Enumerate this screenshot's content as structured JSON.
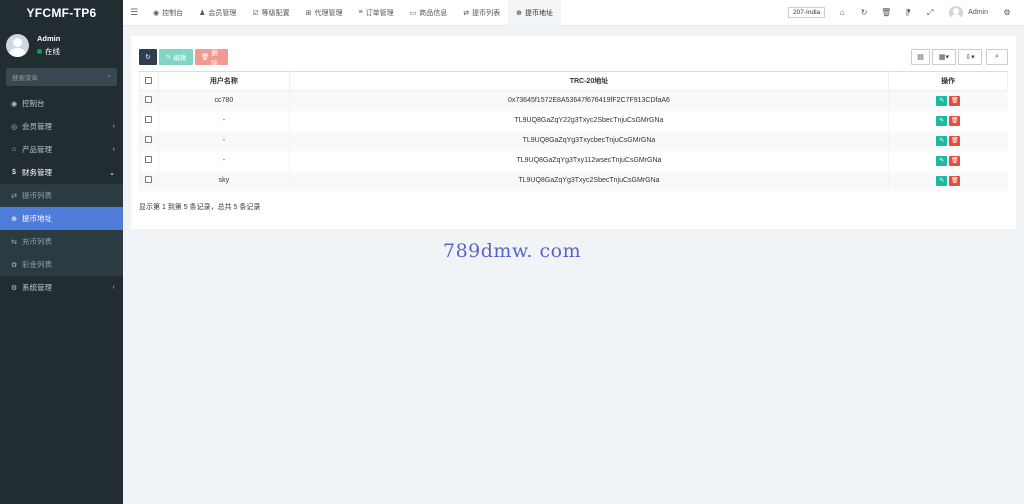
{
  "sidebar": {
    "logo": "YFCMF-TP6",
    "user": {
      "name": "Admin",
      "status": "在线"
    },
    "search_placeholder": "搜索菜单",
    "items": [
      {
        "label": "控制台",
        "icon": "dashboard-icon",
        "type": "top",
        "glyph": "◉"
      },
      {
        "label": "会员管理",
        "icon": "user-circle-icon",
        "type": "top",
        "glyph": "◎",
        "chevron": "‹"
      },
      {
        "label": "产品管理",
        "icon": "home-icon",
        "type": "top",
        "glyph": "⌂",
        "chevron": "‹"
      },
      {
        "label": "财务管理",
        "icon": "dollar-icon",
        "type": "open",
        "glyph": "$",
        "chevron": "⌄"
      },
      {
        "label": "提币列表",
        "icon": "transfer-icon",
        "type": "sub",
        "glyph": "⇄"
      },
      {
        "label": "提币地址",
        "icon": "globe-icon",
        "type": "active",
        "glyph": "⊕"
      },
      {
        "label": "充币列表",
        "icon": "transfer-in-icon",
        "type": "sub",
        "glyph": "⇆"
      },
      {
        "label": "彩金列表",
        "icon": "gift-icon",
        "type": "sub",
        "glyph": "✿"
      },
      {
        "label": "系统管理",
        "icon": "cogs-icon",
        "type": "top",
        "glyph": "⚙",
        "chevron": "‹"
      }
    ]
  },
  "topbar": {
    "tabs": [
      {
        "label": "控制台",
        "icon": "dashboard-icon",
        "glyph": "◉"
      },
      {
        "label": "会员管理",
        "icon": "user-icon",
        "glyph": "♟"
      },
      {
        "label": "等级配置",
        "icon": "check-square-icon",
        "glyph": "☑"
      },
      {
        "label": "代理管理",
        "icon": "sitemap-icon",
        "glyph": "⊞"
      },
      {
        "label": "订单管理",
        "icon": "list-icon",
        "glyph": "≡"
      },
      {
        "label": "商品信息",
        "icon": "monitor-icon",
        "glyph": "▭"
      },
      {
        "label": "提币列表",
        "icon": "transfer-icon",
        "glyph": "⇄"
      },
      {
        "label": "提币地址",
        "icon": "globe-icon",
        "glyph": "⊕",
        "active": true
      }
    ],
    "lang": "207-India",
    "user": "Admin"
  },
  "table": {
    "headers": {
      "username": "用户名称",
      "address": "TRC-20地址",
      "actions": "操作"
    },
    "rows": [
      {
        "username": "cc780",
        "address": "0x73645f1572E8A53647f676419fF2C7F913CDfaA6"
      },
      {
        "username": "-",
        "address": "TL9UQ8GaZqY22g3Txyc2SbecTnjuCsGMrGNa"
      },
      {
        "username": "-",
        "address": "TL9UQ8GaZqYg3TxycbecTnjuCsGMrGNa"
      },
      {
        "username": "-",
        "address": "TL9UQ8GaZqYg3Txy112wsecTnjuCsGMrGNa"
      },
      {
        "username": "sky",
        "address": "TL9UQ8GaZqYg3Txyc2SbecTnjuCsGMrGNa"
      }
    ]
  },
  "toolbar": {
    "edit_label": "编辑",
    "delete_label": "删除"
  },
  "pagination": {
    "info": "显示第 1 到第 5 条记录，总共 5 条记录"
  },
  "watermark": "789dmw. com",
  "colors": {
    "sidebar_bg": "#222d32",
    "active_menu": "#4f7bd9",
    "edit_btn": "#18bc9c",
    "delete_btn": "#e74c3c"
  }
}
